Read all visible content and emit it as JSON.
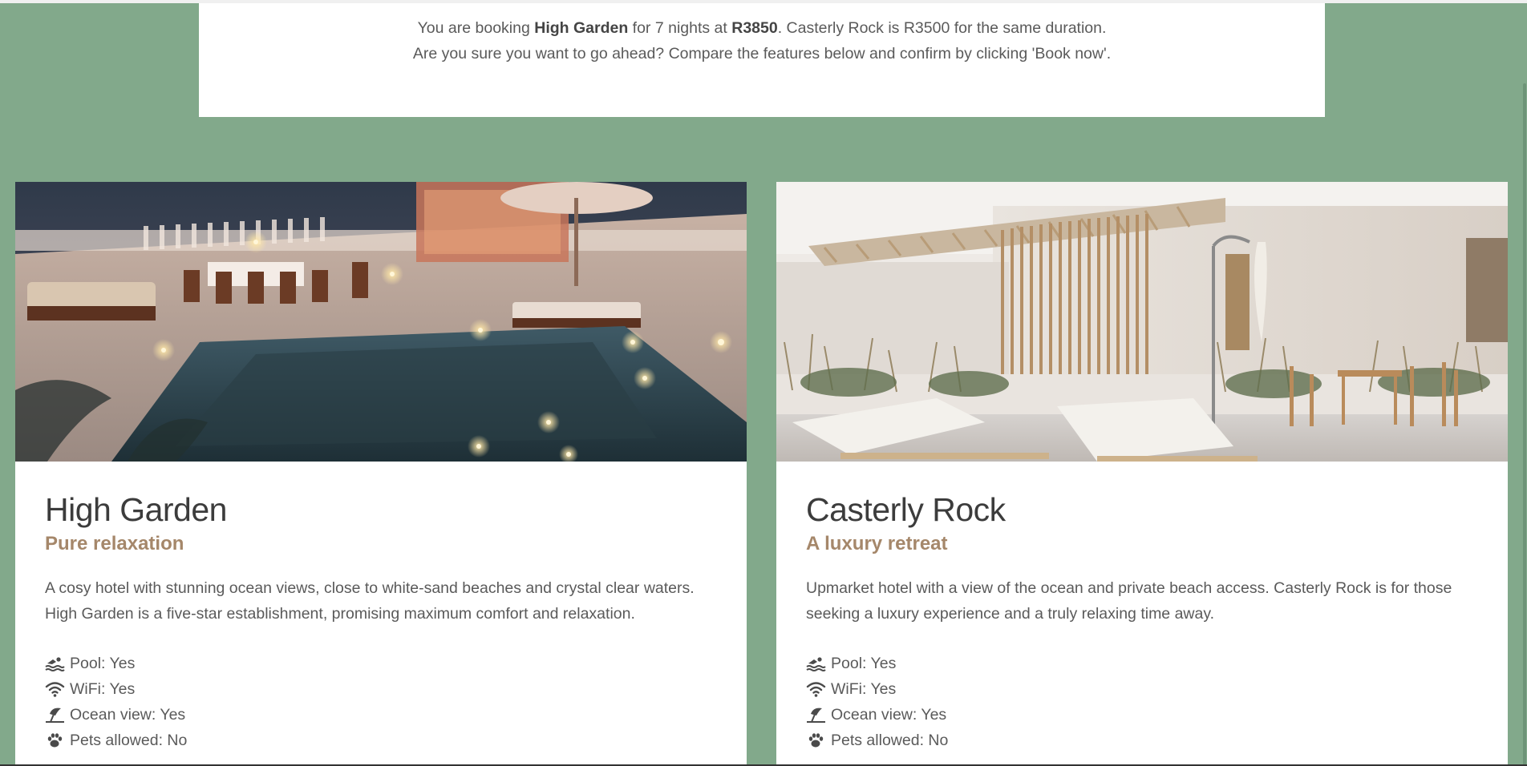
{
  "notice": {
    "line1_prefix": "You are booking ",
    "line1_hotel": "High Garden",
    "line1_mid": " for 7 nights at ",
    "line1_price": "R3850",
    "line1_suffix": ". Casterly Rock is R3500 for the same duration.",
    "line2": "Are you sure you want to go ahead? Compare the features below and confirm by clicking 'Book now'."
  },
  "hotels": [
    {
      "name": "High Garden",
      "tagline": "Pure relaxation",
      "description": "A cosy hotel with stunning ocean views, close to white-sand beaches and crystal clear waters. High Garden is a five-star establishment, promising maximum comfort and relaxation.",
      "features": [
        {
          "icon": "swimmer-icon",
          "text": "Pool: Yes"
        },
        {
          "icon": "wifi-icon",
          "text": "WiFi: Yes"
        },
        {
          "icon": "umbrella-beach-icon",
          "text": "Ocean view: Yes"
        },
        {
          "icon": "paw-icon",
          "text": "Pets allowed: No"
        }
      ]
    },
    {
      "name": "Casterly Rock",
      "tagline": "A luxury retreat",
      "description": "Upmarket hotel with a view of the ocean and private beach access. Casterly Rock is for those seeking a luxury experience and a truly relaxing time away.",
      "features": [
        {
          "icon": "swimmer-icon",
          "text": "Pool: Yes"
        },
        {
          "icon": "wifi-icon",
          "text": "WiFi: Yes"
        },
        {
          "icon": "umbrella-beach-icon",
          "text": "Ocean view: Yes"
        },
        {
          "icon": "paw-icon",
          "text": "Pets allowed: No"
        }
      ]
    }
  ],
  "colors": {
    "background": "#82a98b",
    "tagline": "#a5876a",
    "heading": "#3c3c3c",
    "body_text": "#5a5a5a"
  }
}
